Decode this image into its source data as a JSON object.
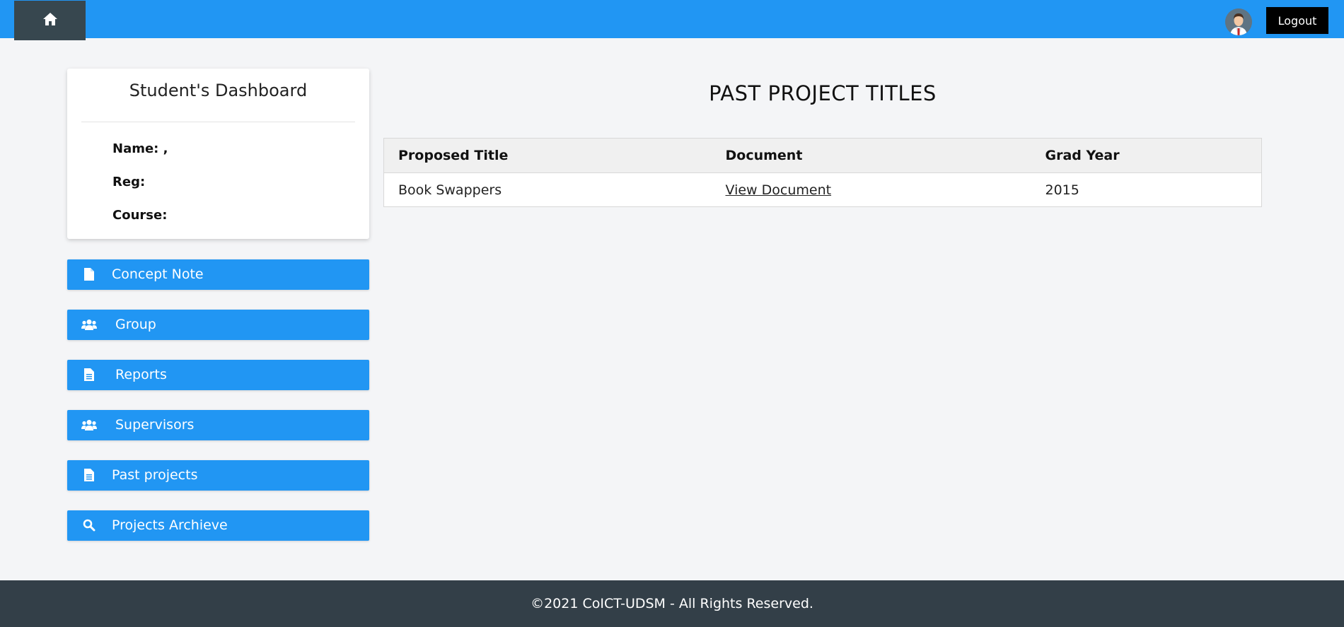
{
  "topbar": {
    "home_icon": "home-icon",
    "avatar_icon": "user-avatar",
    "logout_label": "Logout",
    "accent_color": "#2196f3"
  },
  "dashboard": {
    "title": "Student's Dashboard",
    "name_label": "Name: ,",
    "reg_label": "Reg:",
    "course_label": "Course:"
  },
  "sidebar": {
    "items": [
      {
        "label": "Concept Note",
        "icon": "file-icon"
      },
      {
        "label": "Group",
        "icon": "users-icon"
      },
      {
        "label": "Reports",
        "icon": "file-text-icon"
      },
      {
        "label": "Supervisors",
        "icon": "users-icon"
      },
      {
        "label": "Past projects",
        "icon": "file-text-icon"
      },
      {
        "label": "Projects Archieve",
        "icon": "search-icon"
      }
    ]
  },
  "main": {
    "title": "PAST PROJECT TITLES",
    "table": {
      "headers": [
        "Proposed Title",
        "Document",
        "Grad Year"
      ],
      "rows": [
        {
          "title": "Book Swappers",
          "document": "View Document",
          "year": "2015"
        }
      ]
    }
  },
  "footer": {
    "text": "©2021 CoICT-UDSM - All Rights Reserved."
  }
}
